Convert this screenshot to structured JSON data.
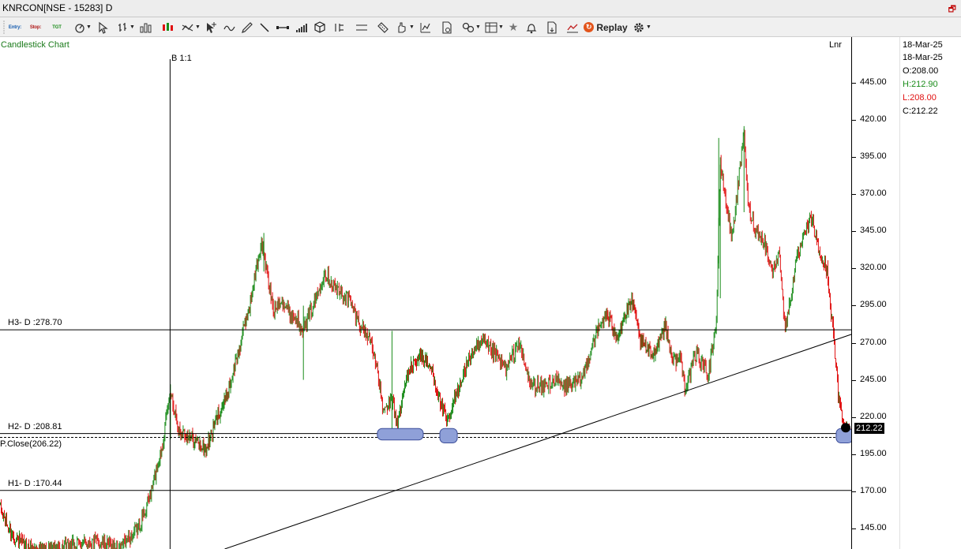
{
  "window": {
    "title": "KNRCON[NSE - 15283] D",
    "control": "🗗"
  },
  "toolbar": {
    "entry_label": "Entry:",
    "stop_label": "Stop:",
    "tgt_label": "TGT",
    "replay_label": "Replay"
  },
  "chart": {
    "name": "Candlestick Chart",
    "bar_ratio": "B 1:1",
    "scale_mode": "Lnr",
    "last_price_label": "212.22"
  },
  "levels": {
    "h3": "H3- D :278.70",
    "h2": "H2- D :208.81",
    "pclose": "P.Close(206.22)",
    "h1": "H1- D :170.44"
  },
  "info": {
    "date1": "18-Mar-25",
    "date2": "18-Mar-25",
    "open": "O:208.00",
    "high": "H:212.90",
    "low": "L:208.00",
    "close": "C:212.22"
  },
  "colors": {
    "bull": "#1a8c1a",
    "bear": "#e01010",
    "level_line": "#000000",
    "highlight": "#8fa0d8",
    "chart_name": "#1a7a1a"
  },
  "chart_data": {
    "type": "candlestick",
    "y_tick_labels": [
      "445.00",
      "420.00",
      "395.00",
      "370.00",
      "345.00",
      "320.00",
      "295.00",
      "270.00",
      "245.00",
      "220.00",
      "195.00",
      "170.00",
      "145.00"
    ],
    "y_ticks": [
      445,
      420,
      395,
      370,
      345,
      320,
      295,
      270,
      245,
      220,
      195,
      170,
      145
    ],
    "ylim": [
      131,
      476
    ],
    "x_count": 1076,
    "levels": [
      278.7,
      208.81,
      206.22,
      170.44
    ],
    "path_anchors": [
      [
        0,
        158
      ],
      [
        10,
        145
      ],
      [
        30,
        132
      ],
      [
        60,
        130
      ],
      [
        120,
        136
      ],
      [
        150,
        131
      ],
      [
        175,
        145
      ],
      [
        190,
        168
      ],
      [
        205,
        202
      ],
      [
        215,
        238
      ],
      [
        225,
        212
      ],
      [
        240,
        206
      ],
      [
        260,
        198
      ],
      [
        275,
        222
      ],
      [
        285,
        232
      ],
      [
        300,
        262
      ],
      [
        315,
        295
      ],
      [
        330,
        338
      ],
      [
        345,
        292
      ],
      [
        355,
        300
      ],
      [
        365,
        290
      ],
      [
        385,
        280
      ],
      [
        400,
        302
      ],
      [
        410,
        318
      ],
      [
        425,
        305
      ],
      [
        440,
        300
      ],
      [
        455,
        282
      ],
      [
        470,
        270
      ],
      [
        485,
        222
      ],
      [
        495,
        232
      ],
      [
        502,
        215
      ],
      [
        515,
        250
      ],
      [
        530,
        262
      ],
      [
        545,
        252
      ],
      [
        555,
        232
      ],
      [
        565,
        215
      ],
      [
        580,
        242
      ],
      [
        595,
        262
      ],
      [
        610,
        270
      ],
      [
        625,
        262
      ],
      [
        640,
        252
      ],
      [
        655,
        270
      ],
      [
        670,
        242
      ],
      [
        685,
        240
      ],
      [
        700,
        245
      ],
      [
        715,
        240
      ],
      [
        735,
        245
      ],
      [
        750,
        272
      ],
      [
        765,
        290
      ],
      [
        780,
        275
      ],
      [
        798,
        298
      ],
      [
        810,
        270
      ],
      [
        825,
        262
      ],
      [
        840,
        282
      ],
      [
        850,
        258
      ],
      [
        860,
        260
      ],
      [
        865,
        240
      ],
      [
        880,
        262
      ],
      [
        895,
        250
      ],
      [
        905,
        285
      ],
      [
        910,
        390
      ],
      [
        920,
        355
      ],
      [
        925,
        342
      ],
      [
        940,
        412
      ],
      [
        945,
        362
      ],
      [
        955,
        345
      ],
      [
        965,
        340
      ],
      [
        975,
        318
      ],
      [
        985,
        330
      ],
      [
        992,
        278
      ],
      [
        1005,
        322
      ],
      [
        1015,
        340
      ],
      [
        1025,
        355
      ],
      [
        1035,
        330
      ],
      [
        1045,
        318
      ],
      [
        1052,
        280
      ],
      [
        1060,
        230
      ],
      [
        1068,
        212
      ],
      [
        1075,
        212
      ]
    ],
    "spike_bars": [
      [
        215,
        242,
        205
      ],
      [
        333,
        344,
        318
      ],
      [
        383,
        295,
        245
      ],
      [
        495,
        278,
        212
      ],
      [
        908,
        408,
        320
      ],
      [
        940,
        416,
        358
      ],
      [
        910,
        390,
        300
      ]
    ],
    "trendline": [
      [
        284,
        131
      ],
      [
        1078,
        276
      ]
    ],
    "highlights": [
      {
        "x1": 477,
        "x2": 535,
        "y1": 204.5,
        "y2": 212.2
      },
      {
        "x1": 556,
        "x2": 578,
        "y1": 202.5,
        "y2": 212.2
      },
      {
        "x1": 1057,
        "x2": 1078,
        "y1": 202.5,
        "y2": 212.2
      }
    ],
    "vertical_marker": 215,
    "last": {
      "open": 208.0,
      "high": 212.9,
      "low": 208.0,
      "close": 212.22
    }
  }
}
